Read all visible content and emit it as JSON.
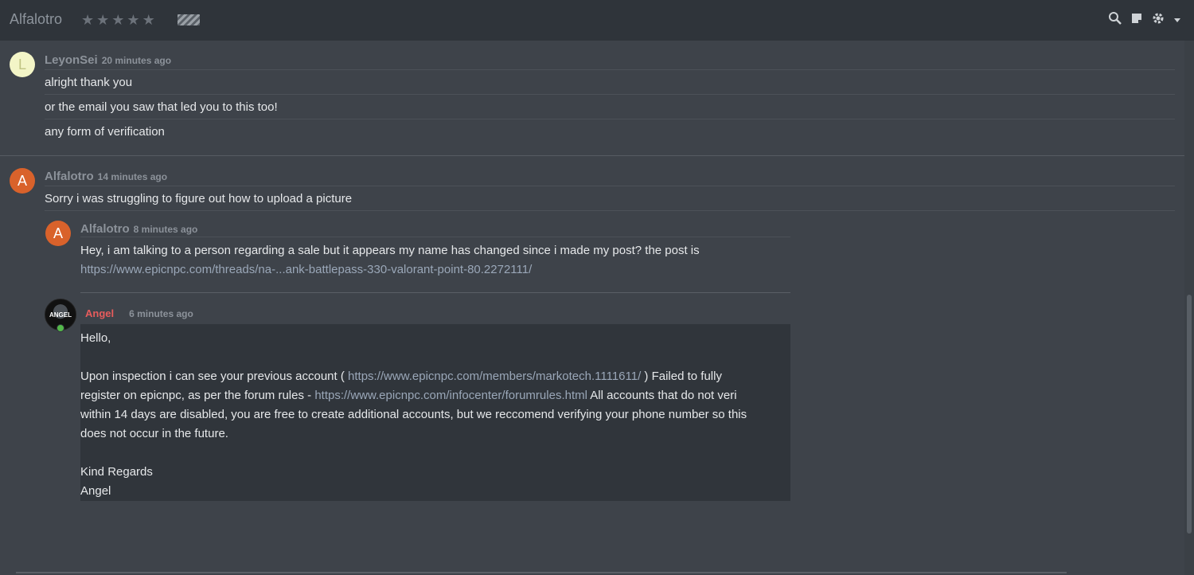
{
  "header": {
    "title": "Alfalotro",
    "rating_stars": 5,
    "icons": [
      "search-icon",
      "note-icon",
      "gear-icon",
      "caret-down-icon"
    ]
  },
  "groups": [
    {
      "avatar_letter": "L",
      "username": "LeyonSei",
      "time": "20 minutes ago",
      "messages": [
        "alright thank you",
        "or the email you saw that led you to this too!",
        "any form of verification"
      ]
    },
    {
      "avatar_letter": "A",
      "username": "Alfalotro",
      "time": "14 minutes ago",
      "messages": [
        "Sorry i was struggling to figure out how to upload a picture"
      ]
    }
  ],
  "nested": {
    "avatar_letter": "A",
    "username": "Alfalotro",
    "time": "8 minutes ago",
    "line1": "Hey, i am talking to a person regarding a sale but it appears my name has changed since i made my post? the post is",
    "link": "https://www.epicnpc.com/threads/na-...ank-battlepass-330-valorant-point-80.2272111/"
  },
  "reply": {
    "avatar_text": "ANGEL",
    "username": "Angel",
    "time": "6 minutes ago",
    "greeting": "Hello,",
    "p1_a": "Upon inspection i can see your previous account ( ",
    "p1_link": "https://www.epicnpc.com/members/markotech.1111611/",
    "p1_b": " ) Failed to fully",
    "p2_a": "register on epicnpc, as per the forum rules - ",
    "p2_link": "https://www.epicnpc.com/infocenter/forumrules.html",
    "p2_b": " All accounts that do not veri",
    "p3": "within 14 days are disabled, you are free to create additional accounts, but we reccomend verifying your phone number so this",
    "p4": "does not occur in the future.",
    "signoff": "Kind Regards",
    "signature": "Angel"
  }
}
